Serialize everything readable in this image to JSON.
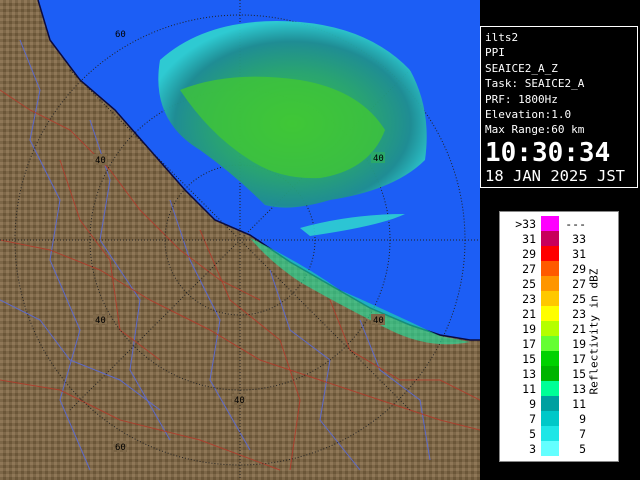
{
  "info": {
    "station": "ilts2",
    "product": "PPI",
    "field": "SEAICE2_A_Z",
    "task": "Task: SEAICE2_A",
    "prf": "PRF: 1800Hz",
    "elevation": "Elevation:1.0",
    "max_range": "Max Range:60 km",
    "time": "10:30:34",
    "date": "18 JAN 2025 JST"
  },
  "map": {
    "range_labels": [
      "60",
      "40",
      "40",
      "40",
      "40",
      "40",
      "60"
    ],
    "colors": {
      "sea": "#1c5ef5",
      "land": "#7d6748",
      "rivers": "#5a6bd8",
      "borders": "#b33a2a"
    }
  },
  "legend": {
    "title": "Reflectivity in dBZ",
    "rows": [
      {
        "lo": ">33",
        "hi": "---",
        "color": "#ff00ff"
      },
      {
        "lo": "31",
        "hi": "33",
        "color": "#c8005a"
      },
      {
        "lo": "29",
        "hi": "31",
        "color": "#ff0000"
      },
      {
        "lo": "27",
        "hi": "29",
        "color": "#ff5a00"
      },
      {
        "lo": "25",
        "hi": "27",
        "color": "#ff9600"
      },
      {
        "lo": "23",
        "hi": "25",
        "color": "#ffc800"
      },
      {
        "lo": "21",
        "hi": "23",
        "color": "#ffff00"
      },
      {
        "lo": "19",
        "hi": "21",
        "color": "#b4ff00"
      },
      {
        "lo": "17",
        "hi": "19",
        "color": "#64ff32"
      },
      {
        "lo": "15",
        "hi": "17",
        "color": "#00d200"
      },
      {
        "lo": "13",
        "hi": "15",
        "color": "#00b400"
      },
      {
        "lo": "11",
        "hi": "13",
        "color": "#00ff96"
      },
      {
        "lo": "9",
        "hi": "11",
        "color": "#00a0a0"
      },
      {
        "lo": "7",
        "hi": "9",
        "color": "#00c8c8"
      },
      {
        "lo": "5",
        "hi": "7",
        "color": "#1ee6e6"
      },
      {
        "lo": "3",
        "hi": "5",
        "color": "#64ffff"
      }
    ]
  }
}
